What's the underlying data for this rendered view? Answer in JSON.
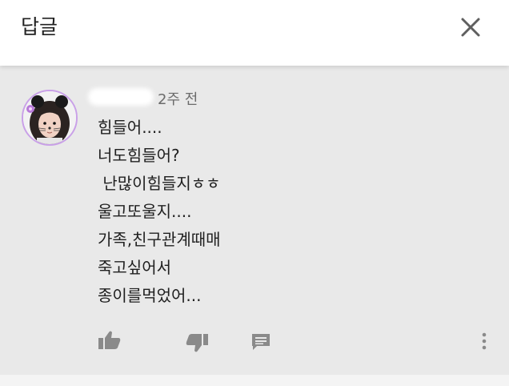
{
  "header": {
    "title": "답글",
    "close_icon": "close-icon"
  },
  "comment": {
    "avatar_icon": "user-avatar",
    "timestamp": "2주 전",
    "lines": [
      "힘들어....",
      "너도힘들어?",
      " 난많이힘들지ㅎㅎ",
      "울고또울지....",
      "가족,친구관계때매",
      "죽고싶어서",
      "종이를먹었어..."
    ],
    "actions": {
      "like_icon": "thumbs-up-icon",
      "dislike_icon": "thumbs-down-icon",
      "reply_icon": "reply-icon",
      "more_icon": "more-vert-icon"
    }
  },
  "colors": {
    "header_bg": "#ffffff",
    "body_bg": "#e9e9e9",
    "avatar_ring": "#c9a0e8",
    "icon_gray": "#8a8a8a"
  }
}
